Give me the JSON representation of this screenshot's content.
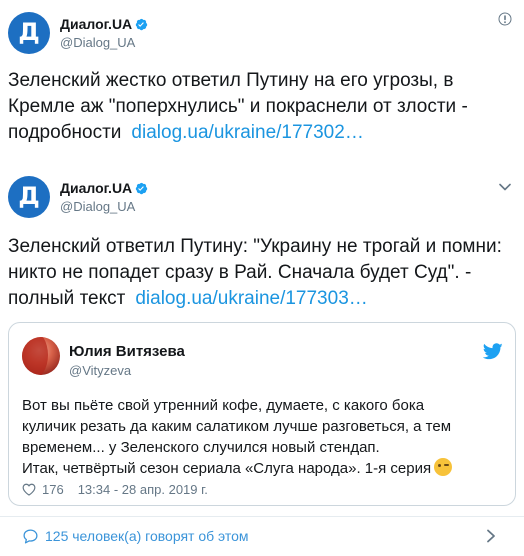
{
  "tweet1": {
    "avatar_letter": "Д",
    "author_name": "Диалог.UA",
    "author_handle": "@Dialog_UA",
    "text": "Зеленский жестко ответил Путину на его угрозы, в Кремле аж \"поперхнулись\" и покраснели от злости - подробности",
    "link": "dialog.ua/ukraine/177302…"
  },
  "tweet2": {
    "avatar_letter": "Д",
    "author_name": "Диалог.UA",
    "author_handle": "@Dialog_UA",
    "text": "Зеленский ответил Путину: \"Украину не трогай и помни: никто не попадет сразу в Рай. Сначала будет Суд\". - полный текст",
    "link": "dialog.ua/ukraine/177303…"
  },
  "quoted": {
    "author_name": "Юлия Витязева",
    "author_handle": "@Vityzeva",
    "lines": [
      "Вот вы пьёте свой утренний кофе, думаете, с какого бока",
      "куличик резать да каким салатиком лучше разговеться, а тем",
      "временем... у Зеленского случился новый стендап.",
      "Итак, четвёртый сезон сериала «Слуга народа». 1-я серия"
    ],
    "likes": "176",
    "timestamp": "13:34 - 28 апр. 2019 г."
  },
  "footer": {
    "people_talking": "125 человек(а) говорят об этом"
  },
  "colors": {
    "brand_blue": "#1d6fc2",
    "link": "#1b95e0",
    "muted": "#657786",
    "twitter_blue": "#1da1f2"
  },
  "icons": [
    "verified-icon",
    "caret-down-icon",
    "twitter-bird-icon",
    "heart-icon",
    "comment-icon",
    "chevron-right-icon",
    "wink-emoji-icon"
  ]
}
